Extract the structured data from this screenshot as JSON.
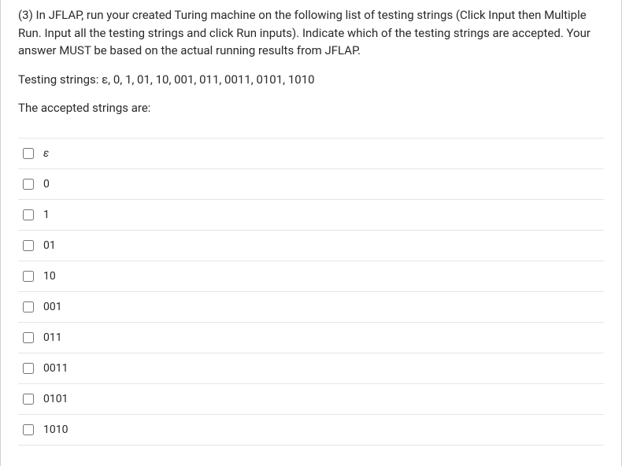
{
  "question": {
    "prompt": "(3) In JFLAP, run your created Turing machine on the following list of testing strings (Click Input then Multiple Run. Input all the testing strings and click Run inputs). Indicate which of the testing strings are accepted. Your answer MUST be based on the actual running results from JFLAP.",
    "testing_strings_line": "Testing strings: ε, 0, 1, 01, 10, 001, 011, 0011, 0101, 1010",
    "accepted_label": "The accepted strings are:"
  },
  "options": [
    {
      "label": "ε",
      "checked": false,
      "italic": true
    },
    {
      "label": "0",
      "checked": false,
      "italic": false
    },
    {
      "label": "1",
      "checked": false,
      "italic": false
    },
    {
      "label": "01",
      "checked": false,
      "italic": false
    },
    {
      "label": "10",
      "checked": false,
      "italic": false
    },
    {
      "label": "001",
      "checked": false,
      "italic": false
    },
    {
      "label": "011",
      "checked": false,
      "italic": false
    },
    {
      "label": "0011",
      "checked": false,
      "italic": false
    },
    {
      "label": "0101",
      "checked": false,
      "italic": false
    },
    {
      "label": "1010",
      "checked": false,
      "italic": false
    }
  ]
}
